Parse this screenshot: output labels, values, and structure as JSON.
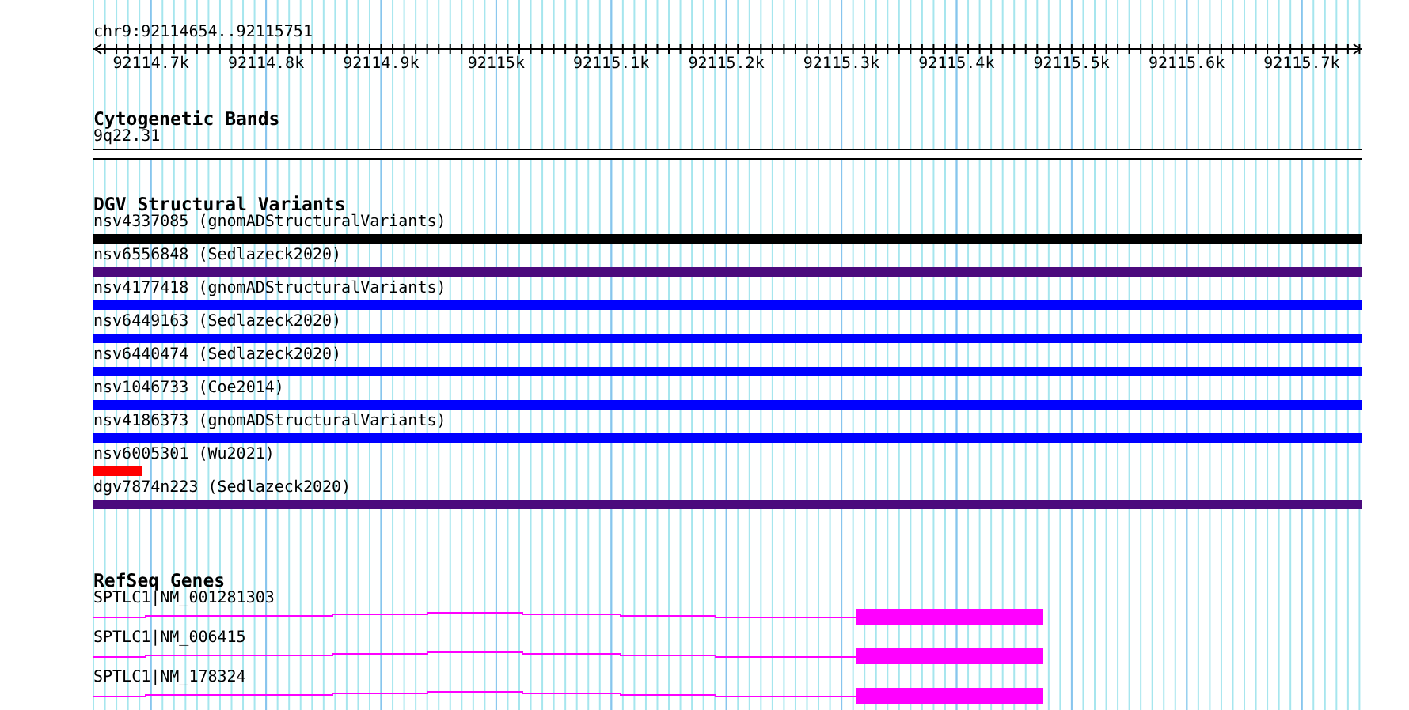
{
  "location": "chr9:92114654..92115751",
  "axis": {
    "tick_labels": [
      "92114.7k",
      "92114.8k",
      "92114.9k",
      "92115k",
      "92115.1k",
      "92115.2k",
      "92115.3k",
      "92115.4k",
      "92115.5k",
      "92115.6k",
      "92115.7k"
    ]
  },
  "tracks": [
    {
      "kind": "cytoband",
      "title": "Cytogenetic Bands",
      "features": [
        {
          "label": "9q22.31"
        }
      ]
    },
    {
      "kind": "variants",
      "title": "DGV Structural Variants",
      "features": [
        {
          "label": "nsv4337085 (gnomADStructuralVariants)",
          "color": "#000000",
          "spans_view": true
        },
        {
          "label": "nsv6556848 (Sedlazeck2020)",
          "color": "#4b0a7d",
          "spans_view": true
        },
        {
          "label": "nsv4177418 (gnomADStructuralVariants)",
          "color": "#0000ff",
          "spans_view": true
        },
        {
          "label": "nsv6449163 (Sedlazeck2020)",
          "color": "#0000ff",
          "spans_view": true
        },
        {
          "label": "nsv6440474 (Sedlazeck2020)",
          "color": "#0000ff",
          "spans_view": true
        },
        {
          "label": "nsv1046733 (Coe2014)",
          "color": "#0000ff",
          "spans_view": true
        },
        {
          "label": "nsv4186373 (gnomADStructuralVariants)",
          "color": "#0000ff",
          "spans_view": true
        },
        {
          "label": "nsv6005301 (Wu2021)",
          "color": "#ff0000",
          "spans_view": false
        },
        {
          "label": "dgv7874n223 (Sedlazeck2020)",
          "color": "#4b0a7d",
          "spans_view": true
        }
      ]
    },
    {
      "kind": "genes",
      "title": "RefSeq Genes",
      "features": [
        {
          "label": "SPTLC1|NM_001281303"
        },
        {
          "label": "SPTLC1|NM_006415"
        },
        {
          "label": "SPTLC1|NM_178324"
        }
      ]
    }
  ]
}
